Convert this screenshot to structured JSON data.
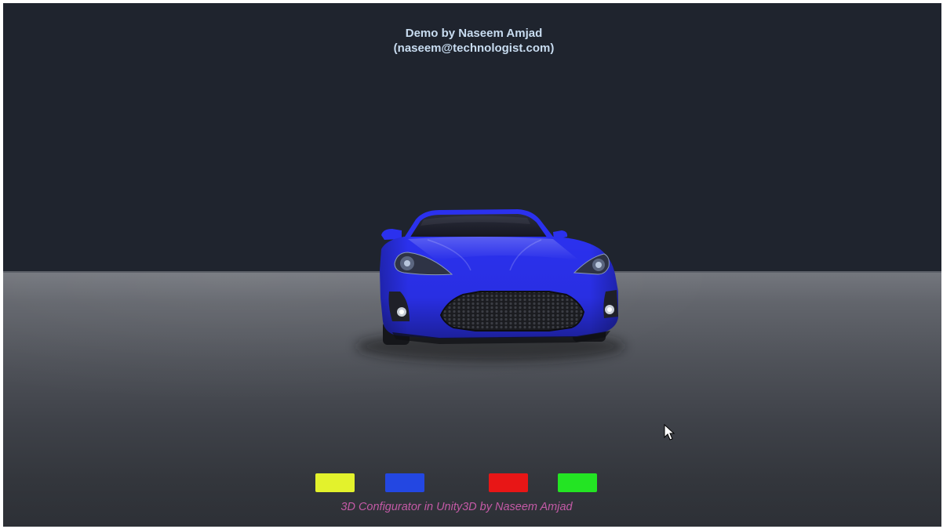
{
  "app": {
    "header_line1": "Demo by Naseem Amjad",
    "header_line2": "(naseem@technologist.com)",
    "footer": "3D Configurator in Unity3D by Naseem Amjad"
  },
  "colors": {
    "sky": "#1f242e",
    "header_text": "#c8dcf0",
    "footer_text": "#c35aa6"
  },
  "car": {
    "body_color": "#2b31ee"
  },
  "swatches": [
    {
      "color": "#e3f22c"
    },
    {
      "color": "#2347e2"
    },
    {
      "color": "#e81616"
    },
    {
      "color": "#23e423"
    }
  ],
  "cursor": {
    "icon": "cursor-arrow-icon"
  }
}
